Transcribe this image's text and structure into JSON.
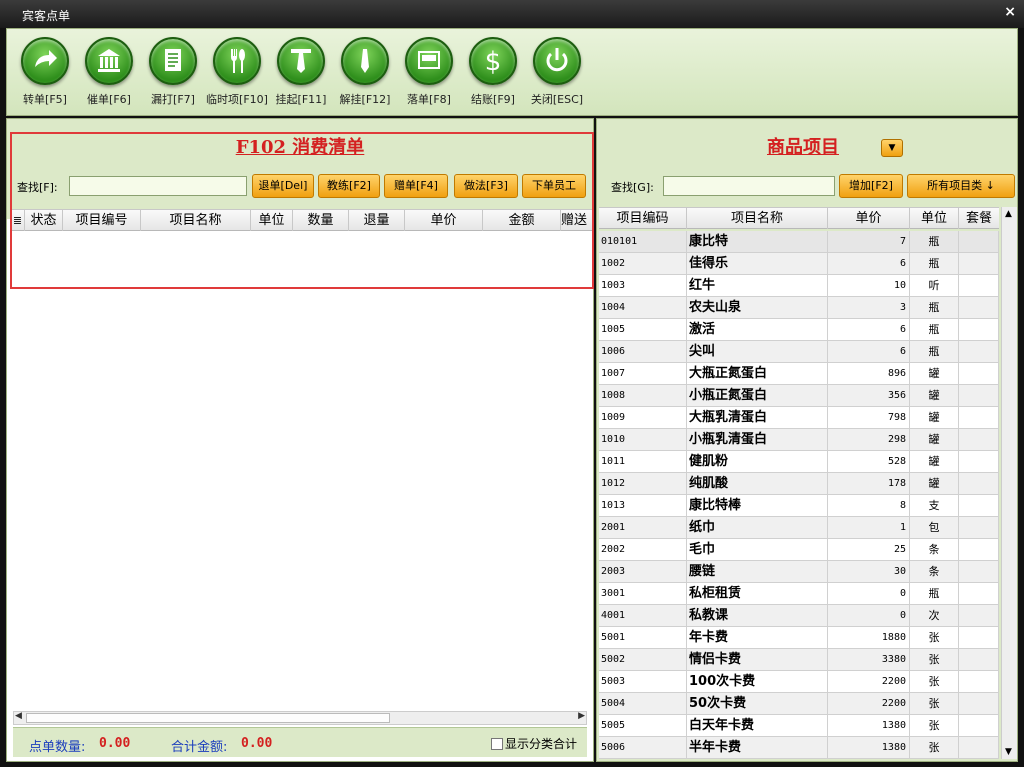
{
  "window": {
    "title": "宾客点单",
    "close": "×"
  },
  "toolbar": [
    {
      "label": "转单[F5]",
      "icon": "forward-arrow-icon"
    },
    {
      "label": "催单[F6]",
      "icon": "bank-icon"
    },
    {
      "label": "漏打[F7]",
      "icon": "document-icon"
    },
    {
      "label": "临时项[F10]",
      "icon": "fork-spoon-icon"
    },
    {
      "label": "挂起[F11]",
      "icon": "tie-icon"
    },
    {
      "label": "解挂[F12]",
      "icon": "tie-single-icon"
    },
    {
      "label": "落单[F8]",
      "icon": "tray-icon"
    },
    {
      "label": "结账[F9]",
      "icon": "dollar-icon"
    },
    {
      "label": "关闭[ESC]",
      "icon": "power-icon"
    }
  ],
  "order": {
    "title": "F102 消费清单",
    "find_label": "查找[F]:",
    "find_value": "",
    "buttons": [
      "退单[Del]",
      "教练[F2]",
      "赠单[F4]",
      "做法[F3]",
      "下单员工"
    ],
    "columns": [
      "≣",
      "状态",
      "项目编号",
      "项目名称",
      "单位",
      "数量",
      "退量",
      "单价",
      "金额",
      "赠送"
    ],
    "rows": [],
    "footer": {
      "count_label": "点单数量:",
      "count_value": "0.00",
      "total_label": "合计金额:",
      "total_value": "0.00",
      "checkbox_label": "显示分类合计"
    }
  },
  "products": {
    "title": "商品项目",
    "find_label": "查找[G]:",
    "find_value": "",
    "add_button": "增加[F2]",
    "category_button": "所有项目类 ↓",
    "columns": [
      "项目编码",
      "项目名称",
      "单价",
      "单位",
      "套餐"
    ],
    "rows": [
      {
        "code": "010101",
        "name": "康比特",
        "price": "7",
        "unit": "瓶"
      },
      {
        "code": "1002",
        "name": "佳得乐",
        "price": "6",
        "unit": "瓶"
      },
      {
        "code": "1003",
        "name": "红牛",
        "price": "10",
        "unit": "听"
      },
      {
        "code": "1004",
        "name": "农夫山泉",
        "price": "3",
        "unit": "瓶"
      },
      {
        "code": "1005",
        "name": "激活",
        "price": "6",
        "unit": "瓶"
      },
      {
        "code": "1006",
        "name": "尖叫",
        "price": "6",
        "unit": "瓶"
      },
      {
        "code": "1007",
        "name": "大瓶正氮蛋白",
        "price": "896",
        "unit": "罐"
      },
      {
        "code": "1008",
        "name": "小瓶正氮蛋白",
        "price": "356",
        "unit": "罐"
      },
      {
        "code": "1009",
        "name": "大瓶乳清蛋白",
        "price": "798",
        "unit": "罐"
      },
      {
        "code": "1010",
        "name": "小瓶乳清蛋白",
        "price": "298",
        "unit": "罐"
      },
      {
        "code": "1011",
        "name": "健肌粉",
        "price": "528",
        "unit": "罐"
      },
      {
        "code": "1012",
        "name": "纯肌酸",
        "price": "178",
        "unit": "罐"
      },
      {
        "code": "1013",
        "name": "康比特棒",
        "price": "8",
        "unit": "支"
      },
      {
        "code": "2001",
        "name": "纸巾",
        "price": "1",
        "unit": "包"
      },
      {
        "code": "2002",
        "name": "毛巾",
        "price": "25",
        "unit": "条"
      },
      {
        "code": "2003",
        "name": "腰链",
        "price": "30",
        "unit": "条"
      },
      {
        "code": "3001",
        "name": "私柜租赁",
        "price": "0",
        "unit": "瓶"
      },
      {
        "code": "4001",
        "name": "私教课",
        "price": "0",
        "unit": "次"
      },
      {
        "code": "5001",
        "name": "年卡费",
        "price": "1880",
        "unit": "张"
      },
      {
        "code": "5002",
        "name": "情侣卡费",
        "price": "3380",
        "unit": "张"
      },
      {
        "code": "5003",
        "name": "100次卡费",
        "price": "2200",
        "unit": "张"
      },
      {
        "code": "5004",
        "name": "50次卡费",
        "price": "2200",
        "unit": "张"
      },
      {
        "code": "5005",
        "name": "白天年卡费",
        "price": "1380",
        "unit": "张"
      },
      {
        "code": "5006",
        "name": "半年卡费",
        "price": "1380",
        "unit": "张"
      }
    ]
  },
  "colors": {
    "accent": "#d42020",
    "panel": "#dce9c8",
    "button": "#f0a010",
    "icon": "#2f8f1c"
  }
}
